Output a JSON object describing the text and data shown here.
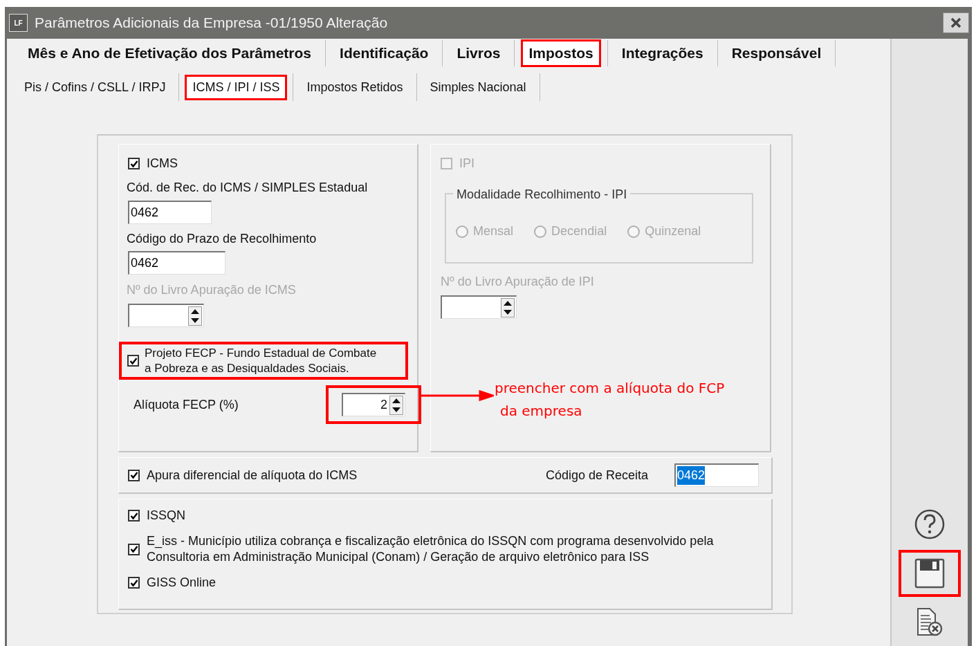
{
  "window": {
    "title": "Parâmetros Adicionais da Empresa -01/1950 Alteração",
    "app_icon": "LF"
  },
  "tabs": [
    {
      "label": "Mês e Ano de Efetivação dos Parâmetros",
      "selected": false,
      "highlighted": false
    },
    {
      "label": "Identificação",
      "selected": false,
      "highlighted": false
    },
    {
      "label": "Livros",
      "selected": false,
      "highlighted": false
    },
    {
      "label": "Impostos",
      "selected": true,
      "highlighted": true
    },
    {
      "label": "Integrações",
      "selected": false,
      "highlighted": false
    },
    {
      "label": "Responsável",
      "selected": false,
      "highlighted": false
    }
  ],
  "subtabs": [
    {
      "label": "Pis / Cofins / CSLL / IRPJ",
      "selected": false,
      "highlighted": false
    },
    {
      "label": "ICMS / IPI / ISS",
      "selected": true,
      "highlighted": true
    },
    {
      "label": "Impostos Retidos",
      "selected": false,
      "highlighted": false
    },
    {
      "label": "Simples Nacional",
      "selected": false,
      "highlighted": false
    }
  ],
  "icms": {
    "checkbox": {
      "label": "ICMS",
      "checked": true
    },
    "cod_rec": {
      "label": "Cód. de Rec. do ICMS / SIMPLES Estadual",
      "value": "0462"
    },
    "cod_prazo": {
      "label": "Código do Prazo de Recolhimento",
      "value": "0462"
    },
    "livro": {
      "label": "Nº do Livro Apuração de ICMS",
      "disabled": true
    },
    "fecp": {
      "label": "Projeto FECP - Fundo Estadual de Combate a Pobreza e as Desiqualdades Sociais.",
      "checked": true,
      "highlighted": true
    },
    "aliquota": {
      "label": "Alíquota FECP (%)",
      "value": "2",
      "highlighted": true
    }
  },
  "ipi": {
    "checkbox": {
      "label": "IPI",
      "checked": false,
      "disabled": true
    },
    "modalidade": {
      "title": "Modalidade Recolhimento - IPI",
      "disabled": true,
      "options": [
        {
          "label": "Mensal",
          "selected": false
        },
        {
          "label": "Decendial",
          "selected": false
        },
        {
          "label": "Quinzenal",
          "selected": false
        }
      ]
    },
    "livro": {
      "label": "Nº do Livro Apuração de IPI",
      "disabled": true
    }
  },
  "annotation": {
    "lines": [
      "preencher com a alíquota do FCP",
      "da empresa"
    ]
  },
  "difal": {
    "checkbox": {
      "label": "Apura diferencial de alíquota do ICMS",
      "checked": true
    },
    "codigo": {
      "label": "Código de Receita",
      "value": "0462",
      "value_selected": true
    }
  },
  "issqn": [
    {
      "label": "ISSQN",
      "checked": true
    },
    {
      "label": "E_iss - Município utiliza cobrança e fiscalização eletrônica do ISSQN com programa desenvolvido pela Consultoria em Administração Municipal (Conam) / Geração de arquivo eletrônico para ISS",
      "checked": true
    },
    {
      "label": "GISS Online",
      "checked": true
    }
  ],
  "sidebar": [
    {
      "kind": "help",
      "highlighted": false
    },
    {
      "kind": "save",
      "highlighted": true
    },
    {
      "kind": "cancel",
      "highlighted": false
    }
  ]
}
